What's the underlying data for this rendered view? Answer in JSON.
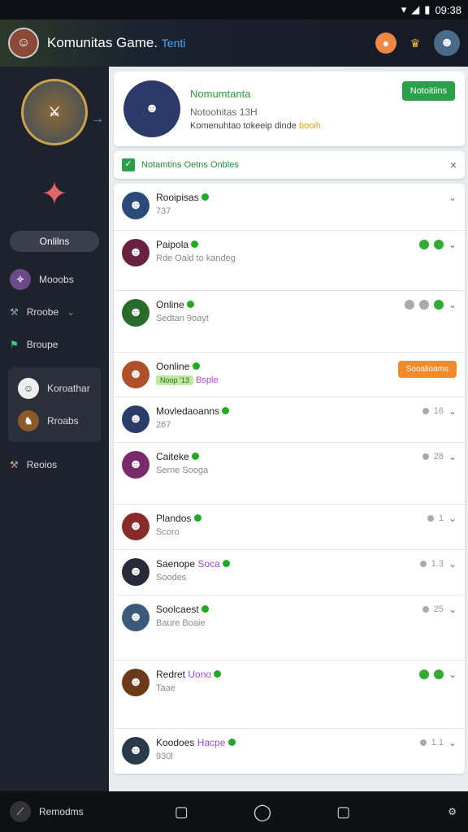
{
  "status": {
    "time": "09:38"
  },
  "header": {
    "title": "Komunitas Game",
    "title_accent": "Tenti"
  },
  "sidebar": {
    "online_button": "Onlilns",
    "items": [
      {
        "label": "Mooobs"
      },
      {
        "label": "Rroobe"
      },
      {
        "label": "Broupe"
      },
      {
        "label": "Koroathar"
      },
      {
        "label": "Rroabs"
      },
      {
        "label": "Reoios"
      }
    ]
  },
  "profile": {
    "name": "Nomumtanta",
    "status": "Notoohitas 13H",
    "desc": "Komenuhtao tokeeip dinde",
    "desc_accent": "booih",
    "button": "Notoitiins"
  },
  "notice": {
    "text": "Notamtins Oetns Onbles"
  },
  "members": [
    {
      "name": "Rooipisas",
      "sub": "737",
      "color": "#2a4a7a"
    },
    {
      "name": "Paipola",
      "sub": "Rde Oald to kandeg",
      "color": "#6a2040",
      "dots": [
        "#3a3",
        "#3a3"
      ]
    },
    {
      "name": "Online",
      "sub": "Sedtan 9oayt",
      "color": "#2a6a2a",
      "dots": [
        "#aaa",
        "#aaa",
        "#3a3"
      ]
    },
    {
      "name": "Oonline",
      "sub_tag": "Noop ’13",
      "sub_accent": "Bsple",
      "color": "#b0502a",
      "button": "Sooalioams"
    },
    {
      "name": "Movledaoanns",
      "sub": "267",
      "color": "#2c3c6a",
      "right": "16"
    },
    {
      "name": "Caiteke",
      "sub": "Serne Sooga",
      "color": "#7a2a6a",
      "right": "28"
    },
    {
      "name": "Plandos",
      "sub": "Scoro",
      "color": "#8a2a2a",
      "right": "1"
    },
    {
      "name": "Saenope",
      "accent": "Soca",
      "sub": "Soodes",
      "color": "#2a2a3a",
      "right": "1.3"
    },
    {
      "name": "Soolcaest",
      "sub": "Baure Boaie",
      "color": "#3a5a7a",
      "right": "25"
    },
    {
      "name": "Redret",
      "accent": "Uono",
      "sub": "Taae",
      "color": "#6a3a1a",
      "dots": [
        "#3a3",
        "#3a3"
      ]
    },
    {
      "name": "Koodoes",
      "accent": "Hacpe",
      "sub": "930l",
      "color": "#2a3a4a",
      "right": "1.1"
    }
  ],
  "navbar": {
    "left_label": "Remodms"
  }
}
